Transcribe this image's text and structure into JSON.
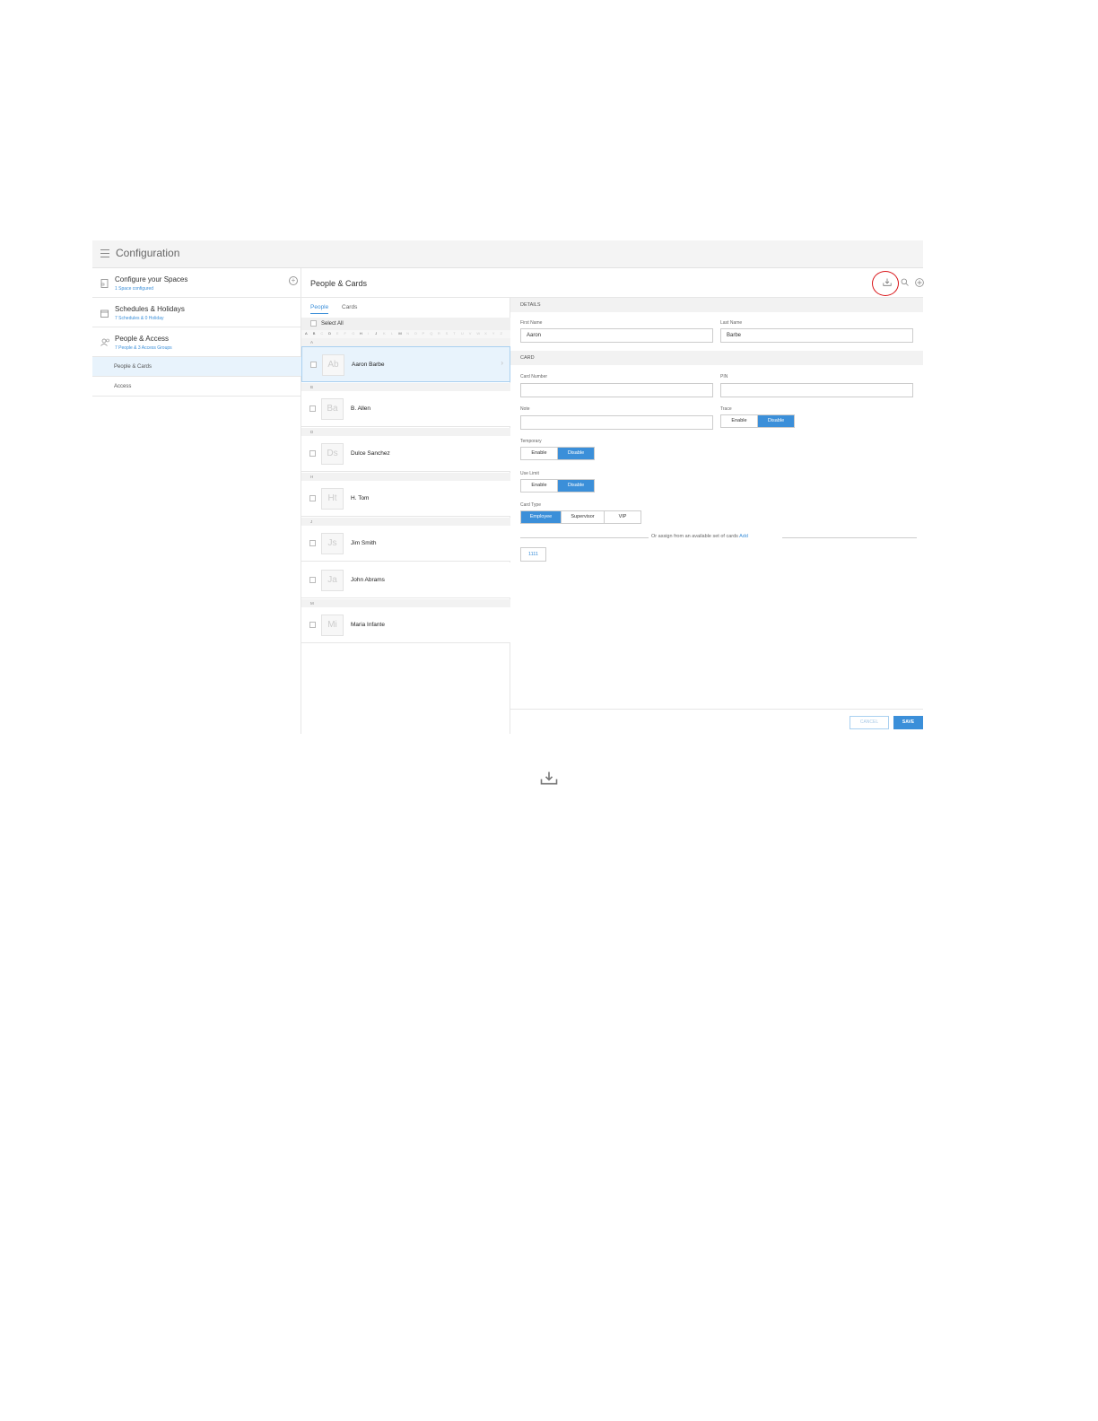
{
  "topbar": {
    "title": "Configuration"
  },
  "sidebar": {
    "items": [
      {
        "title": "Configure your Spaces",
        "subtitle": "1 Space configured"
      },
      {
        "title": "Schedules & Holidays",
        "subtitle": "7 Schedules & 0 Holiday"
      },
      {
        "title": "People & Access",
        "subtitle": "7 People & 3 Access Groups"
      }
    ],
    "children": [
      {
        "label": "People & Cards",
        "active": true
      },
      {
        "label": "Access",
        "active": false
      }
    ]
  },
  "main": {
    "title": "People & Cards"
  },
  "list": {
    "tabs": [
      {
        "label": "People",
        "active": true
      },
      {
        "label": "Cards",
        "active": false
      }
    ],
    "select_all": "Select All",
    "alphabet": [
      "A",
      "B",
      "C",
      "D",
      "E",
      "F",
      "G",
      "H",
      "I",
      "J",
      "K",
      "L",
      "M",
      "N",
      "O",
      "P",
      "Q",
      "R",
      "S",
      "T",
      "U",
      "V",
      "W",
      "X",
      "Y",
      "Z"
    ],
    "alphabet_active": [
      "A",
      "B",
      "D",
      "H",
      "J",
      "M"
    ],
    "groups": [
      {
        "letter": "A",
        "people": [
          {
            "initials": "Ab",
            "name": "Aaron Barbe",
            "active": true
          }
        ]
      },
      {
        "letter": "B",
        "people": [
          {
            "initials": "Ba",
            "name": "B. Allen"
          }
        ]
      },
      {
        "letter": "D",
        "people": [
          {
            "initials": "Ds",
            "name": "Dulce Sanchez"
          }
        ]
      },
      {
        "letter": "H",
        "people": [
          {
            "initials": "Ht",
            "name": "H. Tom"
          }
        ]
      },
      {
        "letter": "J",
        "people": [
          {
            "initials": "Js",
            "name": "Jim Smith"
          },
          {
            "initials": "Ja",
            "name": "John Abrams"
          }
        ]
      },
      {
        "letter": "M",
        "people": [
          {
            "initials": "Mi",
            "name": "Maria Infante"
          }
        ]
      }
    ]
  },
  "details": {
    "section_details": "DETAILS",
    "first_name_label": "First Name",
    "first_name_value": "Aaron",
    "last_name_label": "Last Name",
    "last_name_value": "Barbe",
    "section_card": "CARD",
    "card_number_label": "Card Number",
    "card_number_value": "",
    "pin_label": "PIN",
    "pin_value": "",
    "note_label": "Note",
    "note_value": "",
    "trace_label": "Trace",
    "temporary_label": "Temporary",
    "use_limit_label": "Use Limit",
    "card_type_label": "Card Type",
    "enable": "Enable",
    "disable": "Disable",
    "card_types": [
      "Employee",
      "Supervisor",
      "VIP"
    ],
    "selected_card_type": "Employee",
    "assign_text": "Or assign from an available set of cards",
    "assign_link": "Add",
    "card_chip": "1111",
    "cancel": "CANCEL",
    "save": "SAVE"
  },
  "icons": {
    "accent_color": "#3b8fd9",
    "highlight_color": "#d9161a"
  }
}
